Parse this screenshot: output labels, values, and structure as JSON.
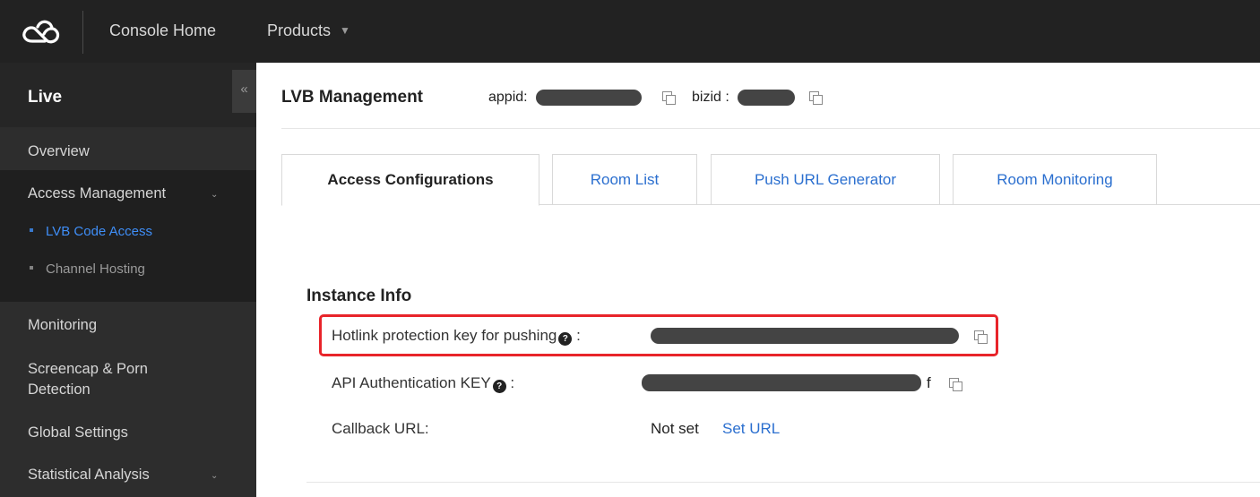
{
  "topbar": {
    "console_home": "Console Home",
    "products": "Products",
    "logo_icon": "cloud-logo-icon"
  },
  "sidebar": {
    "title": "Live",
    "collapse_glyph": "«",
    "items": [
      {
        "label": "Overview"
      },
      {
        "label": "Access Management",
        "expanded": true
      },
      {
        "label": "Monitoring"
      },
      {
        "label": "Screencap & Porn"
      },
      {
        "label": "Detection"
      },
      {
        "label": "Global Settings"
      },
      {
        "label": "Statistical Analysis",
        "expandable": true
      }
    ],
    "sub_items": [
      {
        "label": "LVB Code Access",
        "active": true
      },
      {
        "label": "Channel Hosting",
        "active": false
      }
    ]
  },
  "main": {
    "title": "LVB Management",
    "appid_label": "appid:",
    "bizid_label": "bizid :",
    "tabs": [
      {
        "label": "Access Configurations",
        "active": true
      },
      {
        "label": "Room List",
        "active": false
      },
      {
        "label": "Push URL Generator",
        "active": false
      },
      {
        "label": "Room Monitoring",
        "active": false
      }
    ],
    "instance_info": {
      "title": "Instance Info",
      "hotlink_label": "Hotlink protection key for pushing",
      "api_key_label": "API Authentication KEY",
      "api_key_suffix": "f",
      "callback_label": "Callback URL:",
      "callback_value": "Not set",
      "callback_link": "Set URL",
      "colon": ":"
    }
  },
  "colors": {
    "topbar_bg": "#222222",
    "sidebar_bg": "#2d2d2d",
    "active_blue": "#3f8ef7",
    "link_blue": "#2b6fcf",
    "highlight_red": "#e8242a"
  }
}
